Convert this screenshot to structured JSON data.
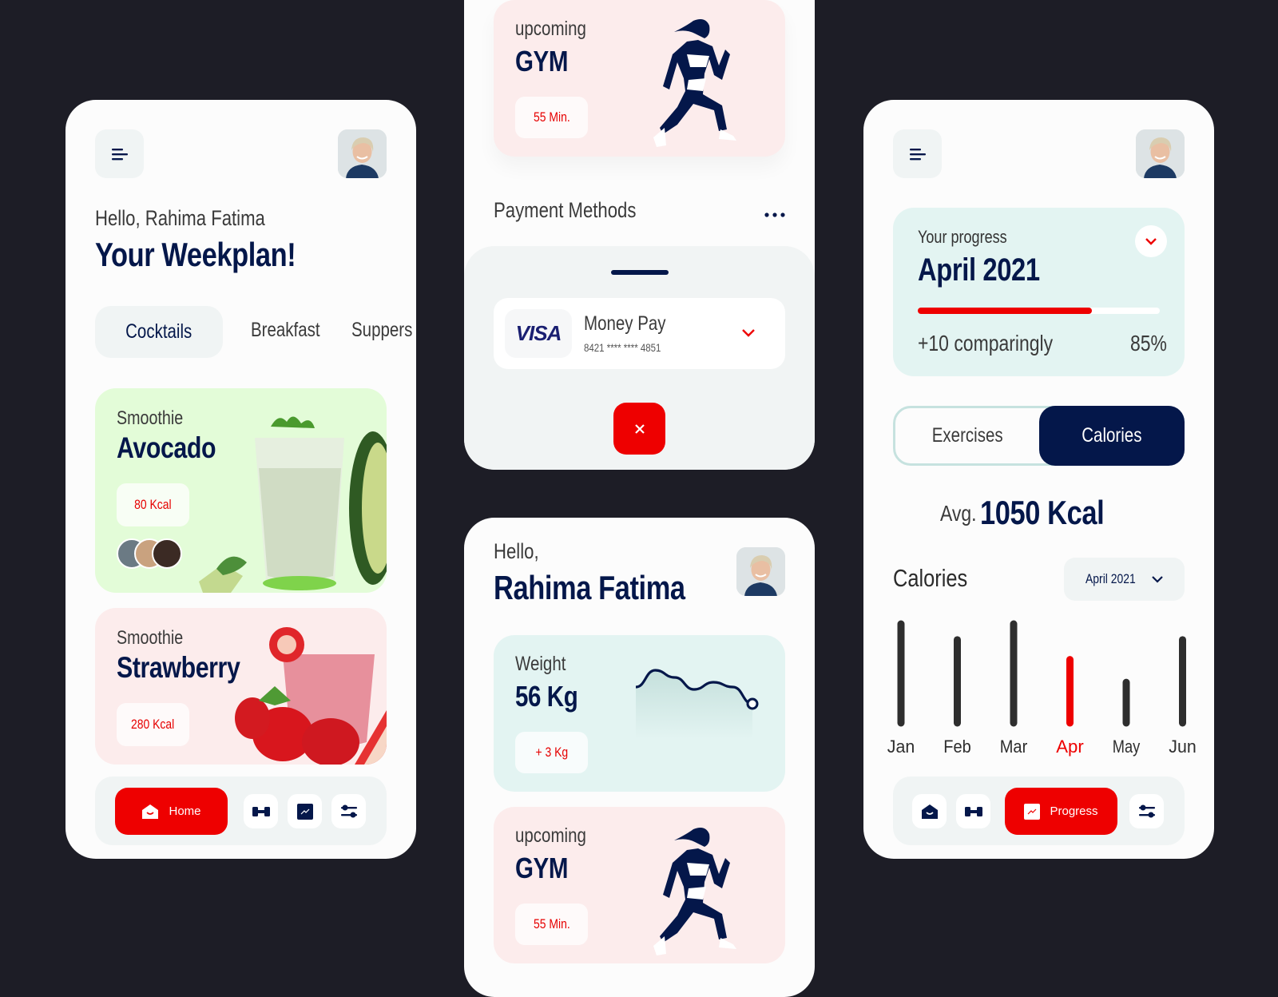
{
  "colors": {
    "accent_red": "#ee0000",
    "navy": "#04174a",
    "background": "#1d1d26",
    "mint": "#e3f4f2",
    "pink": "#fcecec",
    "green": "#e3fcd8"
  },
  "weekplan_screen": {
    "menu_icon": "menu-icon",
    "greeting": "Hello, Rahima Fatima",
    "title": "Your Weekplan!",
    "tabs": [
      {
        "label": "Cocktails",
        "active": true
      },
      {
        "label": "Breakfast",
        "active": false
      },
      {
        "label": "Suppers",
        "active": false
      }
    ],
    "cards": [
      {
        "category": "Smoothie",
        "name": "Avocado",
        "kcal": "80 Kcal",
        "avatars": 3
      },
      {
        "category": "Smoothie",
        "name": "Strawberry",
        "kcal": "280 Kcal"
      }
    ],
    "nav": {
      "home_label": "Home",
      "icons": [
        "dumbbell-icon",
        "chart-icon",
        "settings-sliders-icon"
      ]
    }
  },
  "payment_screen": {
    "gym_card": {
      "label": "upcoming",
      "title": "GYM",
      "duration": "55 Min."
    },
    "section_title": "Payment Methods",
    "more_icon": "more-dots-icon",
    "card": {
      "brand": "VISA",
      "name": "Money Pay",
      "number": "8421 **** **** 4851"
    },
    "close_icon": "close-icon"
  },
  "profile_screen": {
    "greeting": "Hello,",
    "name": "Rahima Fatima",
    "weight": {
      "label": "Weight",
      "value": "56 Kg",
      "change": "+ 3 Kg",
      "trend": [
        0.55,
        0.9,
        0.75,
        0.5,
        0.65,
        0.55,
        0.2
      ]
    },
    "gym_card": {
      "label": "upcoming",
      "title": "GYM",
      "duration": "55 Min."
    }
  },
  "progress_screen": {
    "progress_card": {
      "label": "Your progress",
      "month": "April 2021",
      "progress": 0.72,
      "comparison": "+10 comparingly",
      "percent": "85%"
    },
    "toggle": [
      {
        "label": "Exercises",
        "active": false
      },
      {
        "label": "Calories",
        "active": true
      }
    ],
    "avg_label": "Avg.",
    "avg_value": "1050 Kcal",
    "calories_title": "Calories",
    "month_select": "April 2021",
    "nav": {
      "active_label": "Progress",
      "icons": [
        "home-icon",
        "dumbbell-icon",
        "settings-sliders-icon"
      ]
    }
  },
  "chart_data": {
    "type": "bar",
    "title": "Calories",
    "categories": [
      "Jan",
      "Feb",
      "Mar",
      "Apr",
      "May",
      "Jun"
    ],
    "values": [
      100,
      84,
      100,
      64,
      41,
      84
    ],
    "highlight": "Apr",
    "xlabel": "",
    "ylabel": "",
    "ylim": [
      0,
      100
    ],
    "grid": false
  }
}
